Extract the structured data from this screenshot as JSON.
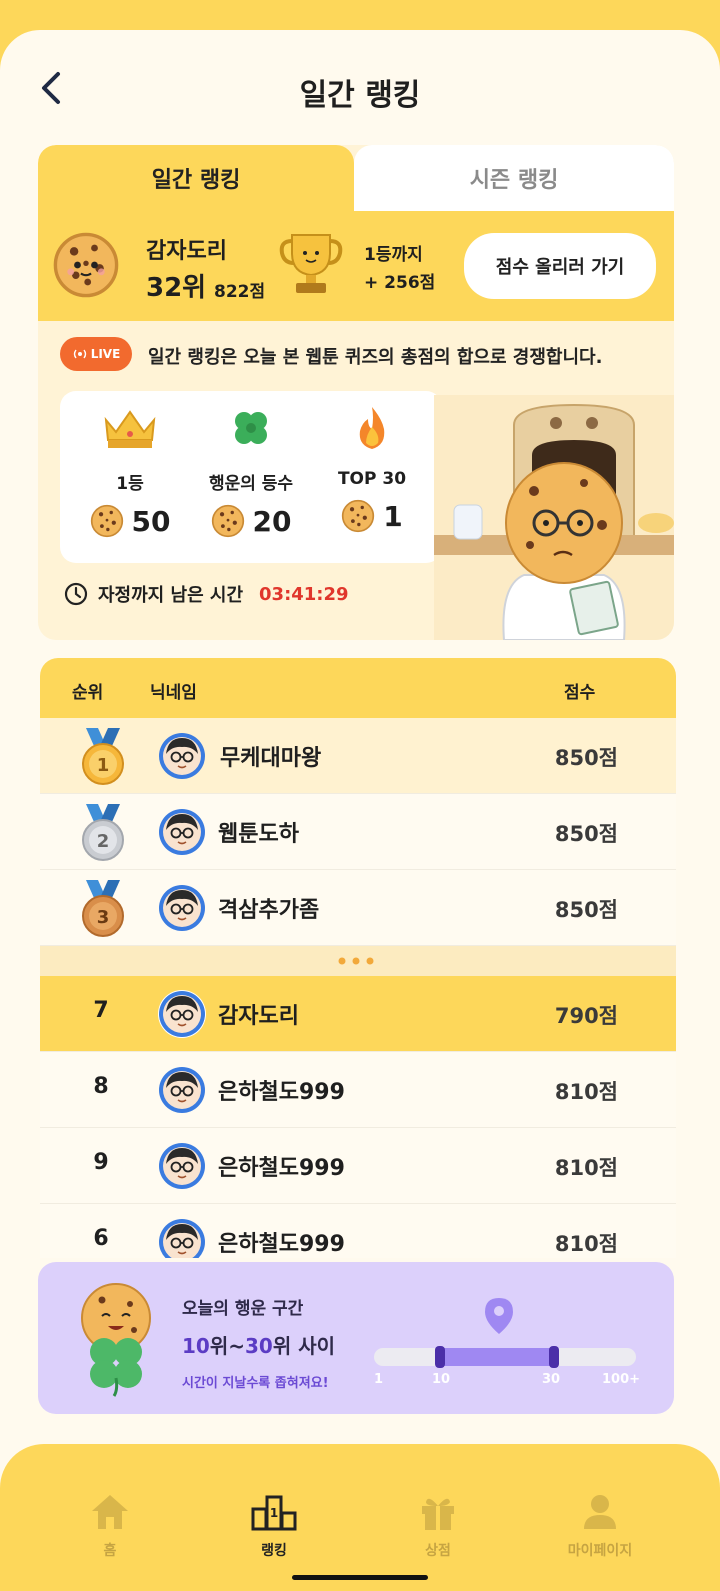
{
  "header": {
    "title": "일간 랭킹"
  },
  "tabs": [
    {
      "label": "일간 랭킹",
      "active": true
    },
    {
      "label": "시즌 랭킹",
      "active": false
    }
  ],
  "me": {
    "name": "감자도리",
    "rank": "32위",
    "score": "822점",
    "gap_line1": "1등까지",
    "gap_line2": "+ 256점",
    "boost_button": "점수 올리러 가기"
  },
  "live": {
    "badge": "LIVE",
    "text": "일간 랭킹은 오늘 본 웹툰 퀴즈의 총점의 합으로 경쟁합니다."
  },
  "prizes": [
    {
      "label": "1등",
      "value": "50",
      "icon": "crown-icon"
    },
    {
      "label": "행운의 등수",
      "value": "20",
      "icon": "clover-icon"
    },
    {
      "label": "TOP 30",
      "value": "1",
      "icon": "fire-icon"
    }
  ],
  "timer": {
    "label": "자정까지 남은 시간",
    "value": "03:41:29"
  },
  "ranking": {
    "headers": {
      "rank": "순위",
      "nickname": "닉네임",
      "score": "점수"
    },
    "top": [
      {
        "medal": "1",
        "name": "무케대마왕",
        "score": "850점"
      },
      {
        "medal": "2",
        "name": "웹툰도하",
        "score": "850점"
      },
      {
        "medal": "3",
        "name": "격삼추가좀",
        "score": "850점"
      }
    ],
    "rows": [
      {
        "rank": "7",
        "name": "감자도리",
        "score": "790점",
        "me": true
      },
      {
        "rank": "8",
        "name": "은하철도999",
        "score": "810점"
      },
      {
        "rank": "9",
        "name": "은하철도999",
        "score": "810점"
      },
      {
        "rank": "6",
        "name": "은하철도999",
        "score": "810점"
      }
    ]
  },
  "lucky": {
    "title": "오늘의 행운 구간",
    "range_a": "10",
    "range_mid": "위~",
    "range_b": "30",
    "range_end": "위 사이",
    "note": "시간이 지날수록 좁혀져요!",
    "ticks": [
      "1",
      "10",
      "30",
      "100+"
    ],
    "range_start": 10,
    "range_stop": 30
  },
  "nav": [
    {
      "label": "홈",
      "icon": "home-icon"
    },
    {
      "label": "랭킹",
      "icon": "podium-icon",
      "active": true
    },
    {
      "label": "상점",
      "icon": "gift-icon"
    },
    {
      "label": "마이페이지",
      "icon": "person-icon"
    }
  ],
  "colors": {
    "brand_yellow": "#FDD75A",
    "live_orange": "#F26A2E",
    "timer_red": "#E0362C",
    "lucky_purple": "#DCD0FB"
  }
}
